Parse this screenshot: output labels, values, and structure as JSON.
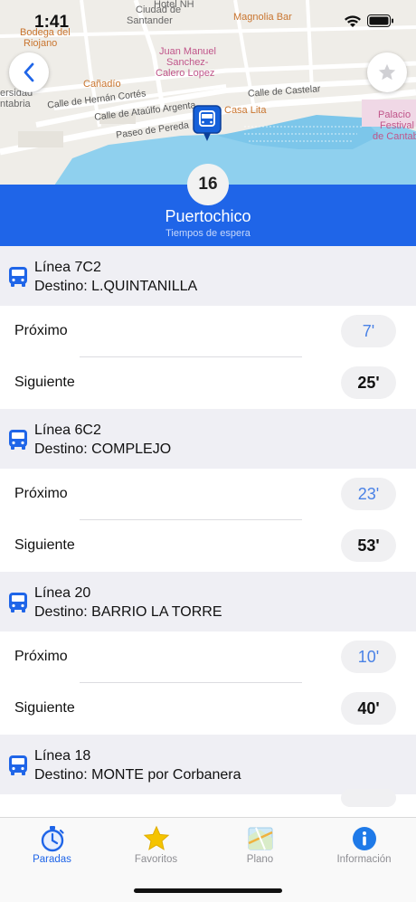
{
  "status_bar": {
    "time": "1:41"
  },
  "map": {
    "labels": {
      "hotel": "Hotel NH",
      "ciudad": "Ciudad de",
      "santander": "Santander",
      "magnolia": "Magnolia Bar",
      "bodega1": "Bodega del",
      "bodega2": "Riojano",
      "juan1": "Juan Manuel",
      "juan2": "Sanchez-",
      "juan3": "Calero Lopez",
      "canadio": "Cañadío",
      "uni1": "ersidad",
      "uni2": "ntabria",
      "hernan": "Calle de Hernán Cortés",
      "ataulfo": "Calle de Ataúlfo Argenta",
      "castelar": "Calle de Castelar",
      "casalita": "Casa Lita",
      "pereda": "Paseo de Pereda",
      "palacio1": "Palacio",
      "palacio2": "Festival",
      "palacio3": "de Cantab"
    }
  },
  "stop": {
    "number": "16",
    "name": "Puertochico",
    "subtitle": "Tiempos de espera"
  },
  "lines": [
    {
      "line": "Línea 7C2",
      "dest": "Destino: L.QUINTANILLA",
      "next_label": "Próximo",
      "next": "7'",
      "after_label": "Siguiente",
      "after": "25'"
    },
    {
      "line": "Línea 6C2",
      "dest": "Destino: COMPLEJO",
      "next_label": "Próximo",
      "next": "23'",
      "after_label": "Siguiente",
      "after": "53'"
    },
    {
      "line": "Línea 20",
      "dest": "Destino: BARRIO LA TORRE",
      "next_label": "Próximo",
      "next": "10'",
      "after_label": "Siguiente",
      "after": "40'"
    },
    {
      "line": "Línea 18",
      "dest": "Destino: MONTE por Corbanera"
    }
  ],
  "tabs": [
    {
      "label": "Paradas",
      "icon": "stopwatch-icon",
      "active": true
    },
    {
      "label": "Favoritos",
      "icon": "star-icon",
      "active": false
    },
    {
      "label": "Plano",
      "icon": "map-icon",
      "active": false
    },
    {
      "label": "Información",
      "icon": "info-icon",
      "active": false
    }
  ],
  "colors": {
    "accent": "#1f65e8",
    "header": "#1f65e8",
    "next_time": "#4a82e6",
    "star": "#f5c400"
  }
}
